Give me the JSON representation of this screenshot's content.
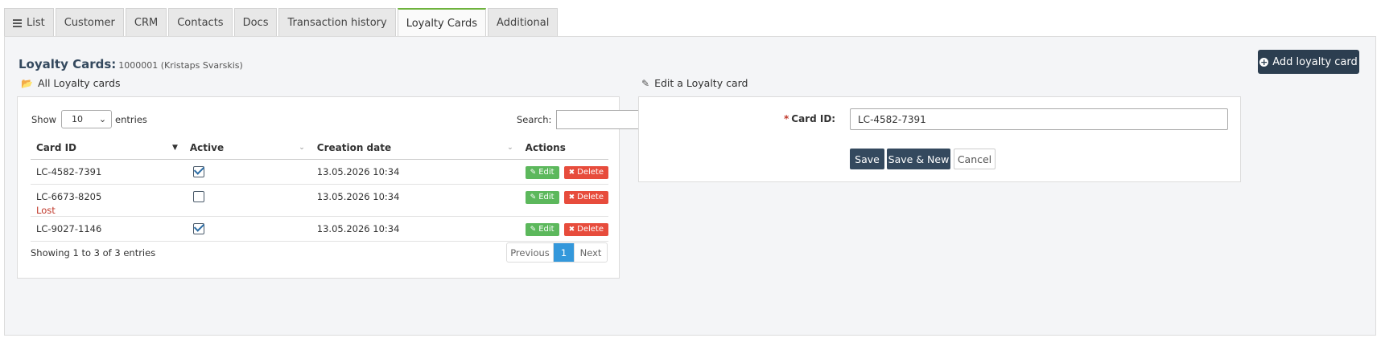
{
  "tabs": [
    {
      "label": "List"
    },
    {
      "label": "Customer"
    },
    {
      "label": "CRM"
    },
    {
      "label": "Contacts"
    },
    {
      "label": "Docs"
    },
    {
      "label": "Transaction history"
    },
    {
      "label": "Loyalty Cards"
    },
    {
      "label": "Additional"
    }
  ],
  "page": {
    "title": "Loyalty Cards:",
    "subtitle": "1000001 (Kristaps Svarskis)",
    "add_button": "Add loyalty card"
  },
  "list_section": {
    "heading": "All Loyalty cards",
    "show_label": "Show",
    "entries_label": "entries",
    "page_size": "10",
    "search_label": "Search:",
    "search_value": "",
    "columns": [
      "Card ID",
      "Active",
      "Creation date",
      "Actions"
    ],
    "rows": [
      {
        "card_id": "LC-4582-7391",
        "status": "",
        "active": true,
        "created": "13.05.2026 10:34"
      },
      {
        "card_id": "LC-6673-8205",
        "status": "Lost",
        "active": false,
        "created": "13.05.2026 10:34"
      },
      {
        "card_id": "LC-9027-1146",
        "status": "",
        "active": true,
        "created": "13.05.2026 10:34"
      }
    ],
    "edit_label": "Edit",
    "delete_label": "Delete",
    "info": "Showing 1 to 3 of 3 entries",
    "pager": {
      "prev": "Previous",
      "current": "1",
      "next": "Next"
    }
  },
  "edit_section": {
    "heading": "Edit a Loyalty card",
    "required_mark": "*",
    "card_id_label": "Card ID:",
    "card_id_value": "LC-4582-7391",
    "save": "Save",
    "save_new": "Save & New",
    "cancel": "Cancel"
  },
  "colors": {
    "accent_tab": "#6fb33e",
    "primary": "#2c3e50",
    "edit": "#5cb85c",
    "delete": "#e74c3c",
    "page_active": "#3498db"
  }
}
